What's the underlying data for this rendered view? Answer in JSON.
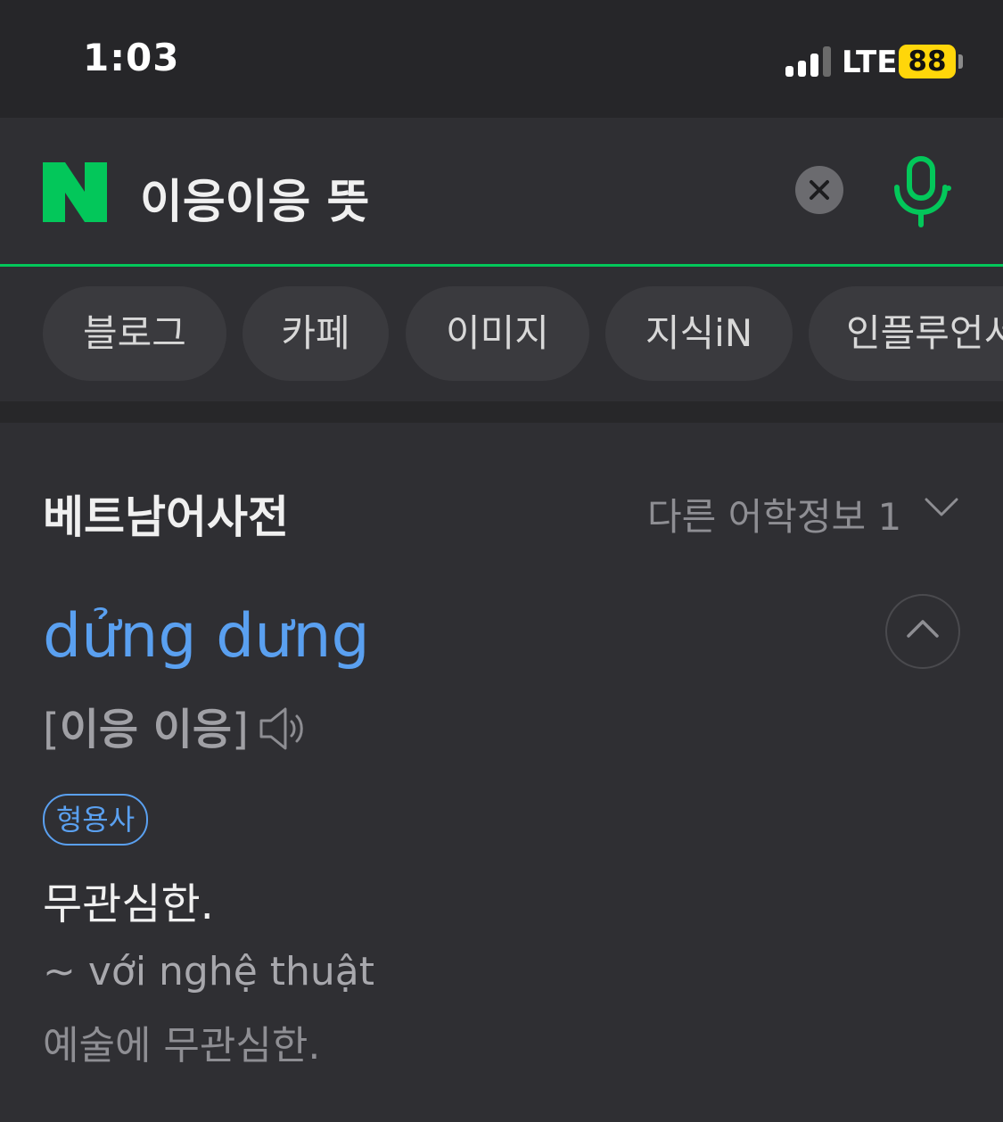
{
  "status_bar": {
    "time": "1:03",
    "network": "LTE",
    "battery": "88",
    "battery_color": "#ffd60a"
  },
  "search": {
    "logo_letter": "N",
    "query": "이응이응 뜻",
    "brand_color": "#03c75a",
    "clear_icon": "close-icon",
    "mic_icon": "microphone-icon"
  },
  "tabs": [
    {
      "label": "블로그"
    },
    {
      "label": "카페"
    },
    {
      "label": "이미지"
    },
    {
      "label": "지식iN"
    },
    {
      "label": "인플루언서"
    }
  ],
  "dictionary": {
    "title": "베트남어사전",
    "other_info": "다른 어학정보 1",
    "headword": "dửng dưng",
    "pronunciation": "이응 이응",
    "pron_open": "[",
    "pron_close": "]",
    "part_of_speech": "형용사",
    "meaning": "무관심한.",
    "example_vi": "~ với nghệ thuật",
    "example_ko": "예술에 무관심한.",
    "accent_color": "#5aa0f0"
  }
}
